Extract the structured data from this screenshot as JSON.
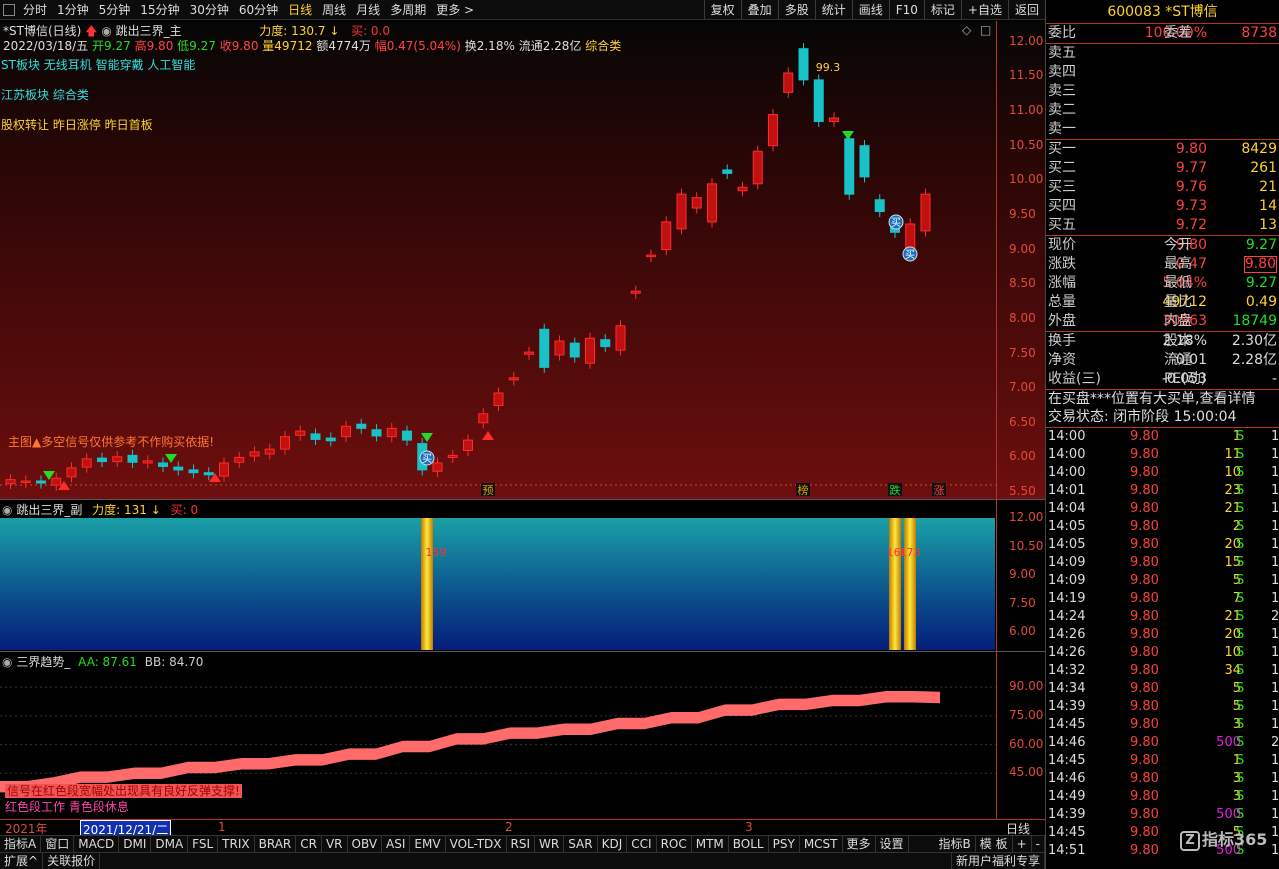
{
  "period_tabs": [
    "分时",
    "1分钟",
    "5分钟",
    "15分钟",
    "30分钟",
    "60分钟",
    "日线",
    "周线",
    "月线",
    "多周期",
    "更多"
  ],
  "active_period": "日线",
  "toolbar": [
    "复权",
    "叠加",
    "多股",
    "统计",
    "画线",
    "F10",
    "标记",
    "+自选",
    "返回"
  ],
  "main": {
    "stock": "*ST博信(日线)",
    "formula": "跳出三界_主",
    "force_label": "力度: 130.7",
    "buy_label": "买: 0.0",
    "info_line": {
      "date": "2022/03/18/五",
      "open": "开9.27",
      "high": "高9.80",
      "low": "低9.27",
      "close": "收9.80",
      "vol": "量49712",
      "amt": "额4774万",
      "range": "幅0.47(5.04%)",
      "turn": "换2.18%",
      "float": "流通2.28亿",
      "sector": "综合类"
    },
    "tags": [
      "ST板块 无线耳机 智能穿戴 人工智能",
      "江苏板块  综合类",
      "股权转让 昨日涨停 昨日首板"
    ],
    "notice": "主图▲多空信号仅供参考不作购买依据!",
    "peak_label": "99.3",
    "yticks": [
      "12.00",
      "11.50",
      "11.00",
      "10.50",
      "10.00",
      "9.50",
      "9.00",
      "8.50",
      "8.00",
      "7.50",
      "7.00",
      "6.50",
      "6.00",
      "5.50"
    ],
    "markers": [
      "预",
      "榜",
      "跌",
      "涨"
    ],
    "buy_marker": "买"
  },
  "chart_data": [
    {
      "type": "candlestick",
      "title": "*ST博信(日线)",
      "candles": [
        {
          "o": 5.62,
          "c": 5.68
        },
        {
          "o": 5.64,
          "c": 5.66
        },
        {
          "o": 5.66,
          "c": 5.63
        },
        {
          "o": 5.6,
          "c": 5.7
        },
        {
          "o": 5.72,
          "c": 5.85
        },
        {
          "o": 5.86,
          "c": 5.98
        },
        {
          "o": 5.99,
          "c": 5.94
        },
        {
          "o": 5.94,
          "c": 6.01
        },
        {
          "o": 6.03,
          "c": 5.93
        },
        {
          "o": 5.92,
          "c": 5.95
        },
        {
          "o": 5.92,
          "c": 5.87
        },
        {
          "o": 5.86,
          "c": 5.82
        },
        {
          "o": 5.82,
          "c": 5.78
        },
        {
          "o": 5.78,
          "c": 5.75
        },
        {
          "o": 5.73,
          "c": 5.92
        },
        {
          "o": 5.93,
          "c": 6.0
        },
        {
          "o": 6.02,
          "c": 6.08
        },
        {
          "o": 6.05,
          "c": 6.12
        },
        {
          "o": 6.12,
          "c": 6.3
        },
        {
          "o": 6.32,
          "c": 6.38
        },
        {
          "o": 6.34,
          "c": 6.26
        },
        {
          "o": 6.28,
          "c": 6.24
        },
        {
          "o": 6.3,
          "c": 6.45
        },
        {
          "o": 6.48,
          "c": 6.42
        },
        {
          "o": 6.4,
          "c": 6.31
        },
        {
          "o": 6.3,
          "c": 6.42
        },
        {
          "o": 6.38,
          "c": 6.25
        },
        {
          "o": 6.2,
          "c": 5.82
        },
        {
          "o": 5.8,
          "c": 5.92
        },
        {
          "o": 6.0,
          "c": 6.03
        },
        {
          "o": 6.1,
          "c": 6.25
        },
        {
          "o": 6.5,
          "c": 6.63
        },
        {
          "o": 6.75,
          "c": 6.93
        },
        {
          "o": 7.12,
          "c": 7.15
        },
        {
          "o": 7.49,
          "c": 7.52
        },
        {
          "o": 7.85,
          "c": 7.3
        },
        {
          "o": 7.48,
          "c": 7.68
        },
        {
          "o": 7.65,
          "c": 7.45
        },
        {
          "o": 7.36,
          "c": 7.72
        },
        {
          "o": 7.7,
          "c": 7.6
        },
        {
          "o": 7.55,
          "c": 7.9
        },
        {
          "o": 8.37,
          "c": 8.4
        },
        {
          "o": 8.9,
          "c": 8.92
        },
        {
          "o": 9.0,
          "c": 9.4
        },
        {
          "o": 9.3,
          "c": 9.8
        },
        {
          "o": 9.6,
          "c": 9.75
        },
        {
          "o": 9.4,
          "c": 9.95
        },
        {
          "o": 10.15,
          "c": 10.1
        },
        {
          "o": 9.85,
          "c": 9.9
        },
        {
          "o": 9.95,
          "c": 10.42
        },
        {
          "o": 10.5,
          "c": 10.95
        },
        {
          "o": 11.27,
          "c": 11.55
        },
        {
          "o": 11.9,
          "c": 11.45
        },
        {
          "o": 11.45,
          "c": 10.85
        },
        {
          "o": 10.85,
          "c": 10.9
        },
        {
          "o": 10.6,
          "c": 9.8
        },
        {
          "o": 10.5,
          "c": 10.05
        },
        {
          "o": 9.72,
          "c": 9.55
        },
        {
          "o": 9.35,
          "c": 9.25
        },
        {
          "o": 8.9,
          "c": 9.37
        },
        {
          "o": 9.27,
          "c": 9.8
        }
      ],
      "ylim": [
        5.4,
        12.3
      ]
    },
    {
      "type": "bar",
      "title": "跳出三界_副",
      "force": "力度: 131",
      "buy": "买: 0",
      "labels": [
        "159",
        "166",
        "173"
      ],
      "yticks": [
        "12.00",
        "10.50",
        "9.00",
        "7.50",
        "6.00"
      ]
    },
    {
      "type": "area",
      "title": "三界趋势_",
      "AA": "AA: 87.61",
      "BB": "BB: 84.70",
      "yticks": [
        "90.00",
        "75.00",
        "60.00",
        "45.00"
      ],
      "values": [
        41,
        41,
        43,
        46,
        46,
        48,
        48,
        51,
        51,
        53,
        53,
        55,
        55,
        58,
        58,
        62,
        62,
        66,
        66,
        69,
        69,
        71,
        71,
        74,
        74,
        77,
        77,
        81,
        81,
        84,
        84,
        86,
        86,
        88,
        88,
        87.61
      ],
      "ylim": [
        30,
        100
      ]
    }
  ],
  "sub": {
    "head": "跳出三界_副",
    "force": "力度: 131",
    "buy": "买: 0"
  },
  "ind": {
    "head": "三界趋势_",
    "aa": "AA: 87.61",
    "bb": "BB: 84.70",
    "note": "信号在红色段宽幅处出现具有良好反弹支撑!",
    "note2": "红色段工作  青色段休息"
  },
  "date_axis": {
    "left": "2021年",
    "cursor": "2021/12/21/二",
    "m1": "1",
    "m2": "2",
    "m3": "3",
    "period": "日线"
  },
  "indicator_tabs": [
    "指标A",
    "窗口",
    "MACD",
    "DMI",
    "DMA",
    "FSL",
    "TRIX",
    "BRAR",
    "CR",
    "VR",
    "OBV",
    "ASI",
    "EMV",
    "VOL-TDX",
    "RSI",
    "WR",
    "SAR",
    "KDJ",
    "CCI",
    "ROC",
    "MTM",
    "BOLL",
    "PSY",
    "MCST",
    "更多",
    "设置",
    "指标B",
    "模 板",
    "+",
    "-"
  ],
  "status": [
    "扩展^",
    "关联报价",
    "新用户福利专享"
  ],
  "quote": {
    "code": "600083 *ST博信",
    "weibi_label": "委比",
    "weibi": "100.00%",
    "weicha_label": "委差",
    "weicha": "8738",
    "sells": [
      {
        "l": "卖五"
      },
      {
        "l": "卖四"
      },
      {
        "l": "卖三"
      },
      {
        "l": "卖二"
      },
      {
        "l": "卖一"
      }
    ],
    "buys": [
      {
        "l": "买一",
        "p": "9.80",
        "v": "8429"
      },
      {
        "l": "买二",
        "p": "9.77",
        "v": "261"
      },
      {
        "l": "买三",
        "p": "9.76",
        "v": "21"
      },
      {
        "l": "买四",
        "p": "9.73",
        "v": "14"
      },
      {
        "l": "买五",
        "p": "9.72",
        "v": "13"
      }
    ],
    "stats1": [
      {
        "l1": "现价",
        "v1": "9.80",
        "c1": "red",
        "l2": "今开",
        "v2": "9.27",
        "c2": "green"
      },
      {
        "l1": "涨跌",
        "v1": "0.47",
        "c1": "red",
        "l2": "最高",
        "v2": "9.80",
        "c2": "red"
      },
      {
        "l1": "涨幅",
        "v1": "5.04%",
        "c1": "red",
        "l2": "最低",
        "v2": "9.27",
        "c2": "green"
      },
      {
        "l1": "总量",
        "v1": "49712",
        "c1": "yellow",
        "l2": "量比",
        "v2": "0.49",
        "c2": "yellow"
      },
      {
        "l1": "外盘",
        "v1": "30963",
        "c1": "red",
        "l2": "内盘",
        "v2": "18749",
        "c2": "green"
      }
    ],
    "stats2": [
      {
        "l1": "换手",
        "v1": "2.18%",
        "l2": "股本",
        "v2": "2.30亿"
      },
      {
        "l1": "净资",
        "v1": "-0.01",
        "l2": "流通",
        "v2": "2.28亿"
      },
      {
        "l1": "收益(三)",
        "v1": "-0.053",
        "l2": "PE(动)",
        "v2": "-"
      }
    ],
    "alert": "在买盘***位置有大买单,查看详情",
    "trade_state": "交易状态: 闭市阶段 15:00:04",
    "ticks": [
      {
        "t": "14:00",
        "p": "9.80",
        "v": "1",
        "s": "S",
        "n": "1"
      },
      {
        "t": "14:00",
        "p": "9.80",
        "v": "11",
        "s": "S",
        "n": "1"
      },
      {
        "t": "14:00",
        "p": "9.80",
        "v": "10",
        "s": "S",
        "n": "1"
      },
      {
        "t": "14:01",
        "p": "9.80",
        "v": "23",
        "s": "S",
        "n": "1"
      },
      {
        "t": "14:04",
        "p": "9.80",
        "v": "21",
        "s": "S",
        "n": "1"
      },
      {
        "t": "14:05",
        "p": "9.80",
        "v": "2",
        "s": "S",
        "n": "1"
      },
      {
        "t": "14:05",
        "p": "9.80",
        "v": "20",
        "s": "S",
        "n": "1"
      },
      {
        "t": "14:09",
        "p": "9.80",
        "v": "15",
        "s": "S",
        "n": "1"
      },
      {
        "t": "14:09",
        "p": "9.80",
        "v": "5",
        "s": "S",
        "n": "1"
      },
      {
        "t": "14:19",
        "p": "9.80",
        "v": "7",
        "s": "S",
        "n": "1"
      },
      {
        "t": "14:24",
        "p": "9.80",
        "v": "21",
        "s": "S",
        "n": "2"
      },
      {
        "t": "14:26",
        "p": "9.80",
        "v": "20",
        "s": "S",
        "n": "1"
      },
      {
        "t": "14:26",
        "p": "9.80",
        "v": "10",
        "s": "S",
        "n": "1"
      },
      {
        "t": "14:32",
        "p": "9.80",
        "v": "34",
        "s": "S",
        "n": "1"
      },
      {
        "t": "14:34",
        "p": "9.80",
        "v": "5",
        "s": "S",
        "n": "1"
      },
      {
        "t": "14:39",
        "p": "9.80",
        "v": "5",
        "s": "S",
        "n": "1"
      },
      {
        "t": "14:45",
        "p": "9.80",
        "v": "3",
        "s": "S",
        "n": "1"
      },
      {
        "t": "14:46",
        "p": "9.80",
        "v": "500",
        "s": "S",
        "n": "2"
      },
      {
        "t": "14:45",
        "p": "9.80",
        "v": "1",
        "s": "S",
        "n": "1"
      },
      {
        "t": "14:46",
        "p": "9.80",
        "v": "3",
        "s": "S",
        "n": "1"
      },
      {
        "t": "14:49",
        "p": "9.80",
        "v": "3",
        "s": "S",
        "n": "1"
      },
      {
        "t": "14:39",
        "p": "9.80",
        "v": "500",
        "s": "S",
        "n": "1"
      },
      {
        "t": "14:45",
        "p": "9.80",
        "v": "5",
        "s": "S",
        "n": "1"
      },
      {
        "t": "14:51",
        "p": "9.80",
        "v": "500",
        "s": "S",
        "n": "1"
      }
    ]
  },
  "watermark": "指标365",
  "watermark_icon": "Z"
}
